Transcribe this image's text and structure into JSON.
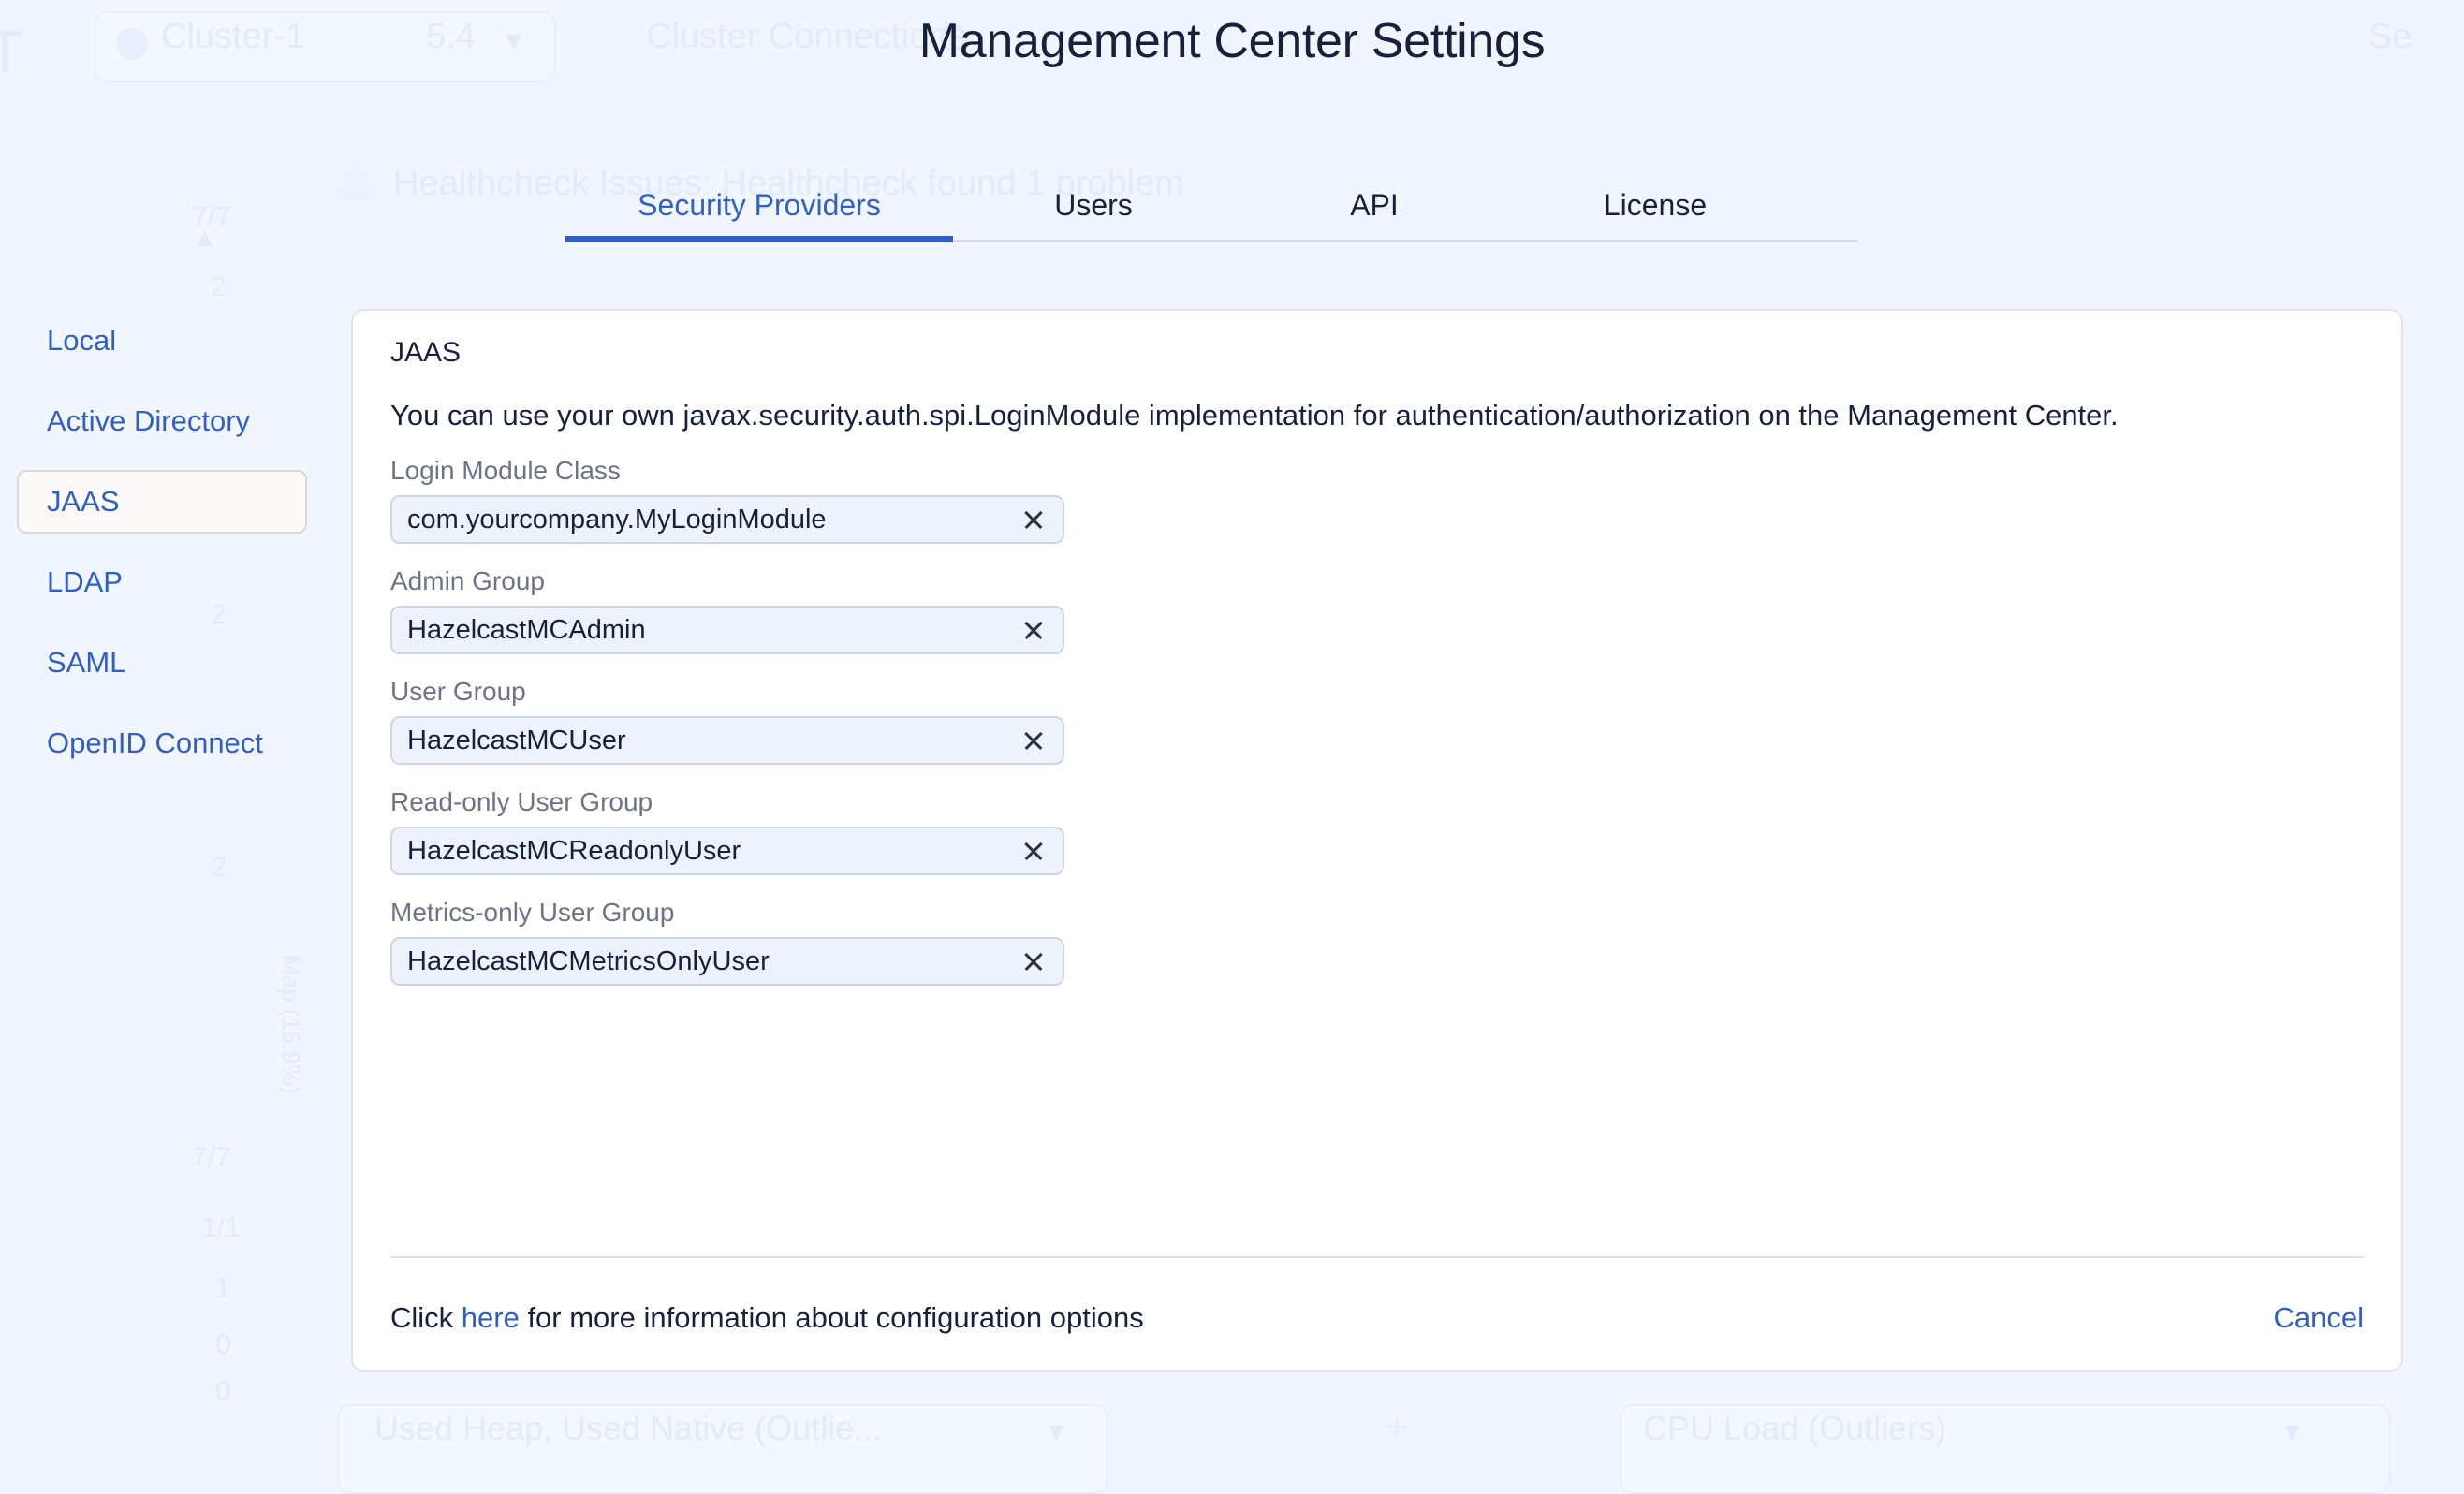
{
  "header": {
    "title": "Management Center Settings"
  },
  "tabs": [
    {
      "label": "Security Providers",
      "active": true
    },
    {
      "label": "Users",
      "active": false
    },
    {
      "label": "API",
      "active": false
    },
    {
      "label": "License",
      "active": false
    }
  ],
  "sidebar": {
    "items": [
      {
        "label": "Local",
        "selected": false
      },
      {
        "label": "Active Directory",
        "selected": false
      },
      {
        "label": "JAAS",
        "selected": true
      },
      {
        "label": "LDAP",
        "selected": false
      },
      {
        "label": "SAML",
        "selected": false
      },
      {
        "label": "OpenID Connect",
        "selected": false
      }
    ]
  },
  "card": {
    "title": "JAAS",
    "description": "You can use your own javax.security.auth.spi.LoginModule implementation for authentication/authorization on the Management Center.",
    "fields": [
      {
        "label": "Login Module Class",
        "value": "com.yourcompany.MyLoginModule",
        "clear_icon": "close-icon"
      },
      {
        "label": "Admin Group",
        "value": "HazelcastMCAdmin",
        "clear_icon": "close-icon"
      },
      {
        "label": "User Group",
        "value": "HazelcastMCUser",
        "clear_icon": "close-icon"
      },
      {
        "label": "Read-only User Group",
        "value": "HazelcastMCReadonlyUser",
        "clear_icon": "close-icon"
      },
      {
        "label": "Metrics-only User Group",
        "value": "HazelcastMCMetricsOnlyUser",
        "clear_icon": "close-icon"
      }
    ],
    "footer": {
      "note_before": "Click ",
      "note_link": "here",
      "note_after": " for more information about configuration options",
      "cancel_label": "Cancel"
    }
  },
  "background": {
    "cluster_name": "Cluster-1",
    "cluster_version": "5.4",
    "cluster_connections": "Cluster Connections",
    "healthcheck": "Healthcheck Issues: Healthcheck found 1 problem",
    "metric_heap": "Used Heap, Used Native (Outlie...",
    "metric_cpu": "CPU Load (Outliers)",
    "stats": [
      "7/7",
      "2",
      "2",
      "2",
      "7/7",
      "1/1",
      "1",
      "0",
      "0"
    ],
    "map_label": "Map (16.9%)",
    "search_label": "Se"
  },
  "colors": {
    "accent": "#2f5ec4",
    "page_bg": "#f1f5fd",
    "card_bg": "#ffffff",
    "title": "#16213c",
    "label": "#6d7487",
    "input_bg": "#edf2fb"
  }
}
